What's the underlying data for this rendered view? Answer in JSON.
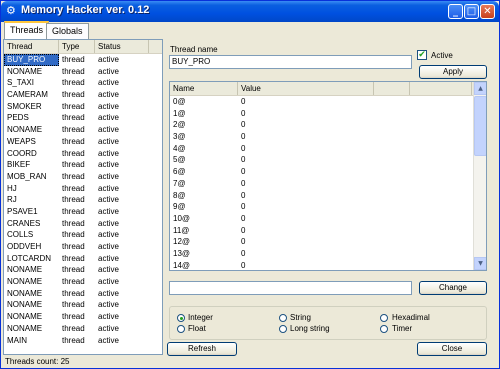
{
  "window": {
    "title": "Memory Hacker ver. 0.12",
    "icon": "gear-icon"
  },
  "tabs": [
    {
      "label": "Threads",
      "active": true
    },
    {
      "label": "Globals",
      "active": false
    }
  ],
  "thread_list": {
    "headers": [
      "Thread",
      "Type",
      "Status"
    ],
    "rows": [
      [
        "BUY_PRO",
        "thread",
        "active"
      ],
      [
        "NONAME",
        "thread",
        "active"
      ],
      [
        "S_TAXI",
        "thread",
        "active"
      ],
      [
        "CAMERAM",
        "thread",
        "active"
      ],
      [
        "SMOKER",
        "thread",
        "active"
      ],
      [
        "PEDS",
        "thread",
        "active"
      ],
      [
        "NONAME",
        "thread",
        "active"
      ],
      [
        "WEAPS",
        "thread",
        "active"
      ],
      [
        "COORD",
        "thread",
        "active"
      ],
      [
        "BIKEF",
        "thread",
        "active"
      ],
      [
        "MOB_RAN",
        "thread",
        "active"
      ],
      [
        "HJ",
        "thread",
        "active"
      ],
      [
        "RJ",
        "thread",
        "active"
      ],
      [
        "PSAVE1",
        "thread",
        "active"
      ],
      [
        "CRANES",
        "thread",
        "active"
      ],
      [
        "COLLS",
        "thread",
        "active"
      ],
      [
        "ODDVEH",
        "thread",
        "active"
      ],
      [
        "LOTCARDN",
        "thread",
        "active"
      ],
      [
        "NONAME",
        "thread",
        "active"
      ],
      [
        "NONAME",
        "thread",
        "active"
      ],
      [
        "NONAME",
        "thread",
        "active"
      ],
      [
        "NONAME",
        "thread",
        "active"
      ],
      [
        "NONAME",
        "thread",
        "active"
      ],
      [
        "NONAME",
        "thread",
        "active"
      ],
      [
        "MAIN",
        "thread",
        "active"
      ]
    ]
  },
  "status_bar": {
    "text": "Threads count: 25"
  },
  "thread_name": {
    "label": "Thread name",
    "value": "BUY_PRO"
  },
  "active_checkbox": {
    "label": "Active",
    "checked": true
  },
  "buttons": {
    "apply": "Apply",
    "change": "Change",
    "refresh": "Refresh",
    "close": "Close"
  },
  "variables": {
    "headers": [
      "Name",
      "Value",
      "",
      ""
    ],
    "rows": [
      [
        "0@",
        "0"
      ],
      [
        "1@",
        "0"
      ],
      [
        "2@",
        "0"
      ],
      [
        "3@",
        "0"
      ],
      [
        "4@",
        "0"
      ],
      [
        "5@",
        "0"
      ],
      [
        "6@",
        "0"
      ],
      [
        "7@",
        "0"
      ],
      [
        "8@",
        "0"
      ],
      [
        "9@",
        "0"
      ],
      [
        "10@",
        "0"
      ],
      [
        "11@",
        "0"
      ],
      [
        "12@",
        "0"
      ],
      [
        "13@",
        "0"
      ],
      [
        "14@",
        "0"
      ]
    ]
  },
  "value_input": {
    "value": ""
  },
  "types": {
    "options": [
      {
        "label": "Integer",
        "checked": true
      },
      {
        "label": "String",
        "checked": false
      },
      {
        "label": "Hexadimal",
        "checked": false
      },
      {
        "label": "Float",
        "checked": false
      },
      {
        "label": "Long string",
        "checked": false
      },
      {
        "label": "Timer",
        "checked": false
      }
    ]
  },
  "colors": {
    "selection": "#316ac5",
    "titlebar": "#0050e0",
    "window_bg": "#ece9d8"
  }
}
